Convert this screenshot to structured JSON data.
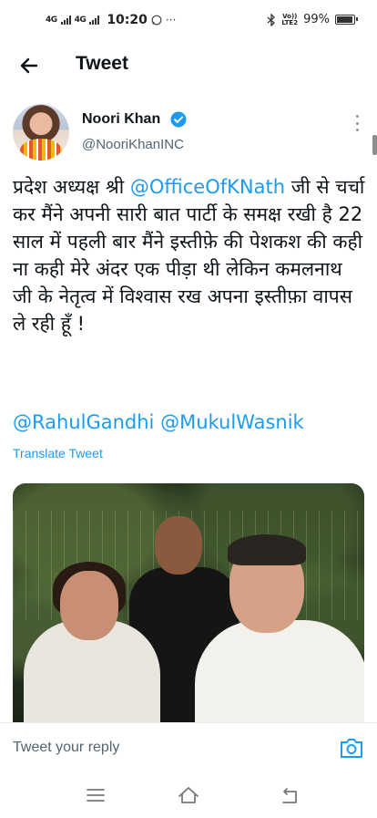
{
  "status_bar": {
    "network1": "4G",
    "network2": "4G",
    "time": "10:20",
    "whatsapp_icon": "whatsapp-icon",
    "more": "···",
    "volte_line1": "Vo))",
    "volte_line2": "LTE2",
    "battery_text": "99%",
    "battery_level": 0.99
  },
  "header": {
    "back_icon": "arrow-left-icon",
    "title": "Tweet"
  },
  "tweet": {
    "author_name": "Noori Khan",
    "verified_icon": "verified-badge-icon",
    "handle": "@NooriKhanINC",
    "more_icon": "more-vertical-icon",
    "text_before_mention": "प्रदेश अध्यक्ष श्री ",
    "mention_1": "@OfficeOfKNath",
    "text_after_mention": " जी से चर्चा कर मैंने अपनी सारी बात पार्टी के समक्ष रखी है 22 साल में पहली बार मैंने इस्तीफ़े की पेशकश की कही ना कही मेरे अंदर एक पीड़ा थी लेकिन कमलनाथ जी के नेतृत्व में विश्वास रख अपना इस्तीफ़ा वापस ले रही हूँ !",
    "mention_2": "@RahulGandhi",
    "mention_3": "@MukulWasnik",
    "translate_label": "Translate Tweet"
  },
  "reply": {
    "placeholder": "Tweet your reply",
    "camera_icon": "camera-icon"
  },
  "nav": {
    "menu_icon": "menu-icon",
    "home_icon": "home-icon",
    "back_icon": "back-icon"
  }
}
